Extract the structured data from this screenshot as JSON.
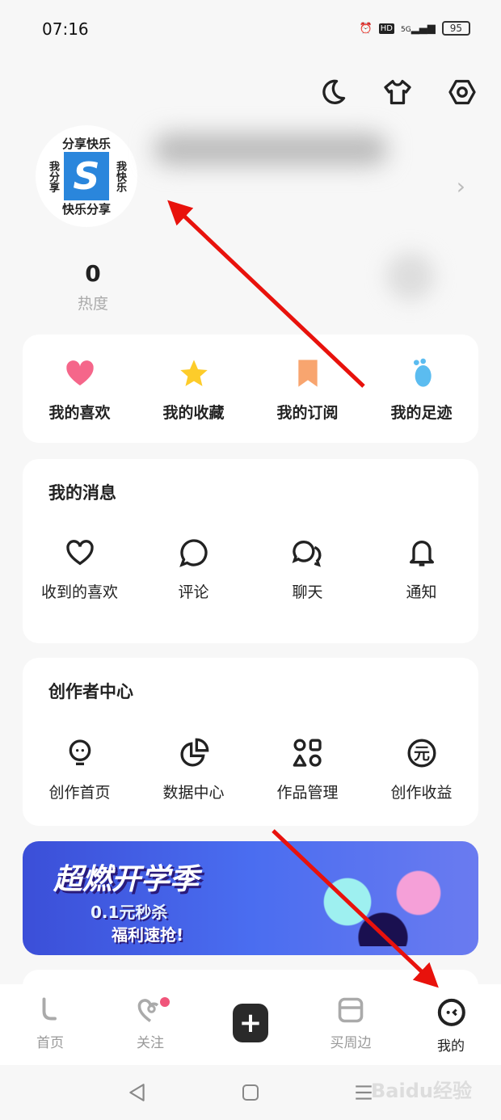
{
  "status_bar": {
    "time": "07:16",
    "network": "5G",
    "battery": "95",
    "icons": [
      "alarm-icon",
      "hd-icon",
      "signal-icon",
      "battery-icon"
    ]
  },
  "header": {
    "icons": [
      "moon-icon",
      "tshirt-icon",
      "settings-icon"
    ]
  },
  "profile": {
    "avatar_text": {
      "top": "分享快乐",
      "left": "我分享",
      "right": "我快乐",
      "bottom": "快乐分享"
    },
    "stat_value": "0",
    "stat_label": "热度"
  },
  "quick_actions": [
    {
      "label": "我的喜欢",
      "icon": "heart-icon",
      "color": "#f5668a"
    },
    {
      "label": "我的收藏",
      "icon": "star-icon",
      "color": "#fdcc2a"
    },
    {
      "label": "我的订阅",
      "icon": "bookmark-icon",
      "color": "#f8a56f"
    },
    {
      "label": "我的足迹",
      "icon": "footprint-icon",
      "color": "#5bbcf0"
    }
  ],
  "messages": {
    "title": "我的消息",
    "items": [
      {
        "label": "收到的喜欢",
        "icon": "heart-outline-icon"
      },
      {
        "label": "评论",
        "icon": "comment-icon"
      },
      {
        "label": "聊天",
        "icon": "chat-icon"
      },
      {
        "label": "通知",
        "icon": "bell-icon"
      }
    ]
  },
  "creator": {
    "title": "创作者中心",
    "items": [
      {
        "label": "创作首页",
        "icon": "bulb-icon"
      },
      {
        "label": "数据中心",
        "icon": "pie-chart-icon"
      },
      {
        "label": "作品管理",
        "icon": "shapes-icon"
      },
      {
        "label": "创作收益",
        "icon": "yuan-icon"
      }
    ]
  },
  "banner": {
    "title": "超燃开学季",
    "line1": "0.1元秒杀",
    "line2": "福利速抢!"
  },
  "bottom_nav": [
    {
      "label": "首页",
      "icon": "home-icon"
    },
    {
      "label": "关注",
      "icon": "follow-icon",
      "badge": true
    },
    {
      "label": "",
      "icon": "plus-icon"
    },
    {
      "label": "买周边",
      "icon": "shop-icon"
    },
    {
      "label": "我的",
      "icon": "me-icon",
      "active": true
    }
  ],
  "watermark": "Baidu经验"
}
